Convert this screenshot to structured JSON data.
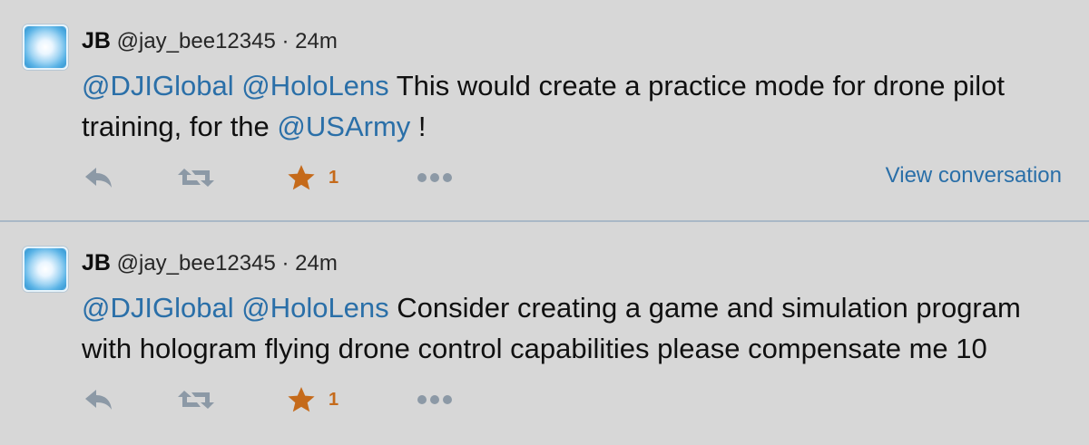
{
  "tweets": [
    {
      "name": "JB",
      "handle": "@jay_bee12345",
      "separator": "·",
      "time": "24m",
      "mention1": "@DJIGlobal",
      "mention2": "@HoloLens",
      "text_main": "This would create a practice mode for drone pilot training, for the",
      "mention3": "@USArmy",
      "text_end": "!",
      "favorite_count": "1",
      "view_conversation": "View conversation"
    },
    {
      "name": "JB",
      "handle": "@jay_bee12345",
      "separator": "·",
      "time": "24m",
      "mention1": "@DJIGlobal",
      "mention2": "@HoloLens",
      "text_main": "Consider creating a game and simulation program with hologram flying drone control capabilities please compensate me 10",
      "favorite_count": "1"
    }
  ],
  "icons": {
    "reply": "reply-icon",
    "retweet": "retweet-icon",
    "favorite": "star-icon",
    "more": "more-icon"
  },
  "colors": {
    "background": "#d7d7d7",
    "link": "#2a6fa8",
    "favorite": "#c56a1a",
    "action_icon": "#8c99a6",
    "divider": "#a9b8c6"
  }
}
